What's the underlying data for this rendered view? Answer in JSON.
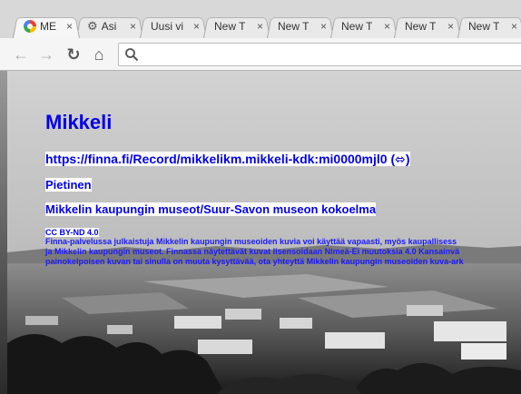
{
  "tabs": [
    {
      "title": "ME",
      "icon": "google-icon",
      "active": true
    },
    {
      "title": "Asi",
      "icon": "gear-icon",
      "active": false
    },
    {
      "title": "Uusi vi",
      "icon": "",
      "active": false
    },
    {
      "title": "New T",
      "icon": "",
      "active": false
    },
    {
      "title": "New T",
      "icon": "",
      "active": false
    },
    {
      "title": "New T",
      "icon": "",
      "active": false
    },
    {
      "title": "New T",
      "icon": "",
      "active": false
    },
    {
      "title": "New T",
      "icon": "",
      "active": false
    }
  ],
  "tab_close_glyph": "×",
  "toolbar": {
    "back_glyph": "←",
    "forward_glyph": "→",
    "reload_glyph": "↻",
    "home_glyph": "⌂"
  },
  "omnibox": {
    "value": ""
  },
  "record": {
    "title": "Mikkeli",
    "link": "https://finna.fi/Record/mikkelikm.mikkeli-kdk:mi0000mjl0 (⬄)",
    "author": "Pietinen",
    "organization": "Mikkelin kaupungin museot/Suur-Savon museon kokoelma",
    "license": "CC BY-ND 4.0",
    "description_lines": [
      "Finna-palvelussa julkaistuja Mikkelin kaupungin museoiden kuvia voi käyttää vapaasti, myös kaupallisess",
      "ja Mikkelin kaupungin museot. Finnassa näytettävät kuvat lisensoidaan Nimeä-Ei muutoksia 4.0 Kansainvä",
      "painokelpoisen kuvan tai sinulla on muuta kysyttävää, ota yhteyttä Mikkelin kaupungin museoiden kuva-ark"
    ]
  }
}
